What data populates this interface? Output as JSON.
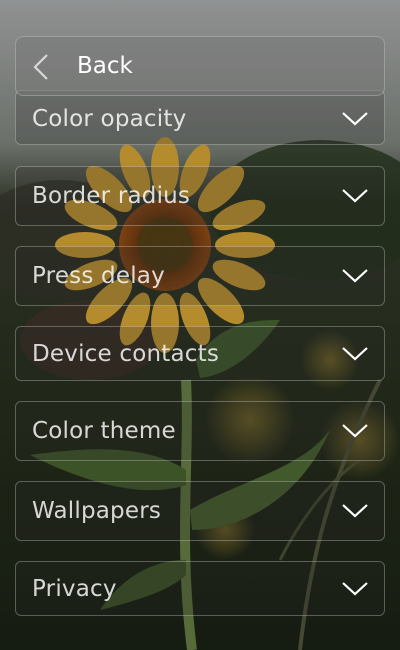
{
  "header": {
    "back_label": "Back"
  },
  "menu": {
    "items": [
      {
        "label": "Color opacity"
      },
      {
        "label": "Border radius"
      },
      {
        "label": "Press delay"
      },
      {
        "label": "Device contacts"
      },
      {
        "label": "Color theme"
      },
      {
        "label": "Wallpapers"
      },
      {
        "label": "Privacy"
      }
    ]
  },
  "icons": {
    "back": "chevron-left-icon",
    "expand": "chevron-down-icon"
  },
  "colors": {
    "text": "#ffffff",
    "header_bg": "#7a7a7a"
  }
}
